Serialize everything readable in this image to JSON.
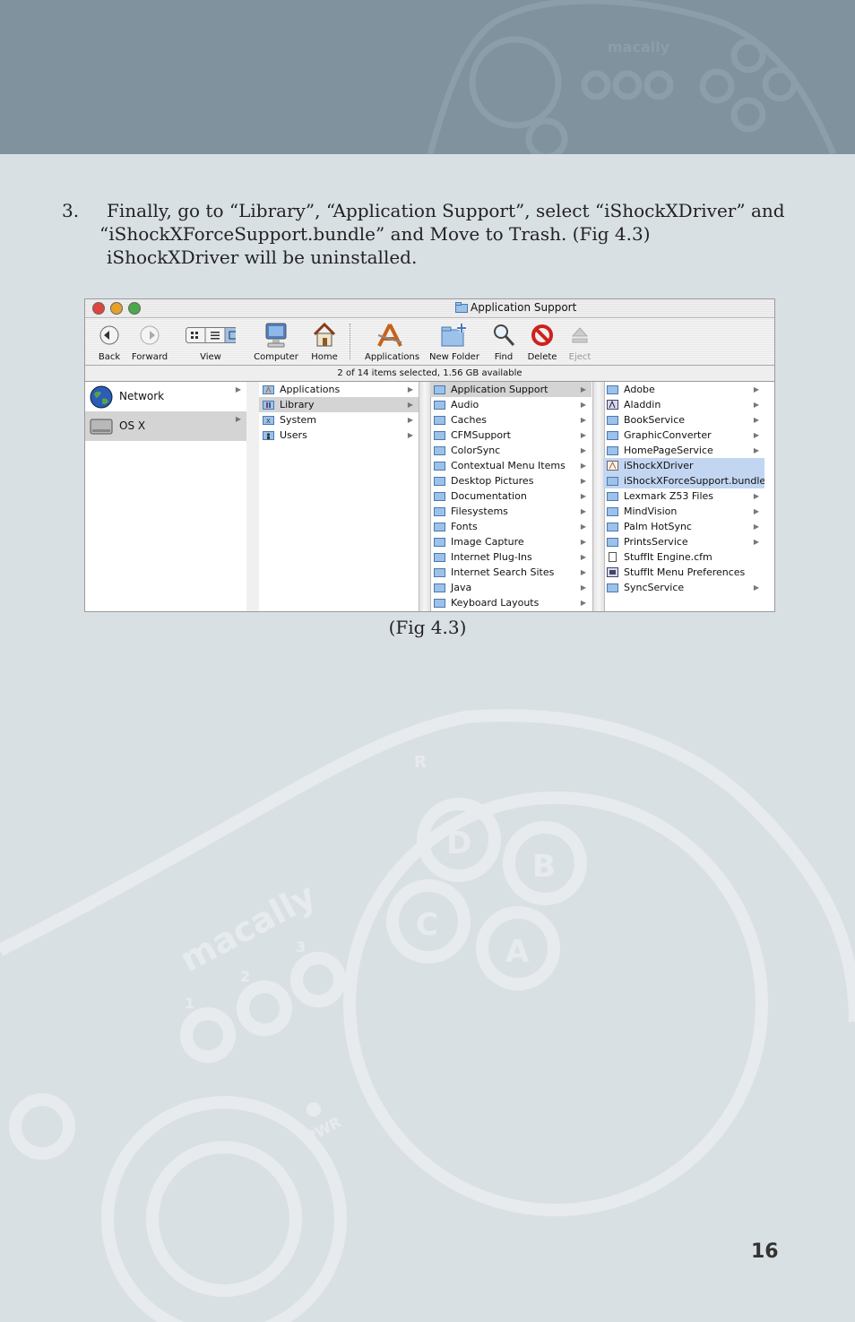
{
  "instructions": {
    "step_number": "3.",
    "line1": "Finally, go to “Library”, “Application Support”, select “iShockXDriver” and",
    "line2": "“iShockXForceSupport.bundle” and Move to Trash. (Fig 4.3)",
    "line3": "iShockXDriver will be uninstalled."
  },
  "figure": {
    "caption": "(Fig 4.3)",
    "window_title": "Application Support",
    "toolbar": {
      "back": "Back",
      "forward": "Forward",
      "view": "View",
      "computer": "Computer",
      "home": "Home",
      "applications": "Applications",
      "new_folder": "New Folder",
      "find": "Find",
      "delete": "Delete",
      "eject": "Eject"
    },
    "status": "2 of 14 items selected, 1.56 GB available",
    "columns": {
      "volumes": [
        "Network",
        "OS X"
      ],
      "root": [
        "Applications",
        "Library",
        "System",
        "Users"
      ],
      "library": [
        "Application Support",
        "Audio",
        "Caches",
        "CFMSupport",
        "ColorSync",
        "Contextual Menu Items",
        "Desktop Pictures",
        "Documentation",
        "Filesystems",
        "Fonts",
        "Image Capture",
        "Internet Plug-Ins",
        "Internet Search Sites",
        "Java",
        "Keyboard Layouts"
      ],
      "app_support": [
        "Adobe",
        "Aladdin",
        "BookService",
        "GraphicConverter",
        "HomePageService",
        "iShockXDriver",
        "iShockXForceSupport.bundle",
        "Lexmark Z53 Files",
        "MindVision",
        "Palm HotSync",
        "PrintsService",
        "StuffIt Engine.cfm",
        "StuffIt Menu Preferences",
        "SyncService"
      ]
    }
  },
  "decor": {
    "header_logo": "macally",
    "big_logo": "macally",
    "button_letters": [
      "D",
      "B",
      "C",
      "A",
      "R"
    ],
    "button_numbers": [
      "1",
      "2",
      "3"
    ],
    "pwr": "PWR"
  },
  "page_number": "16",
  "colors": {
    "header": "#7f929e",
    "page": "#d9e0e4",
    "decor": "#e7ebee"
  }
}
